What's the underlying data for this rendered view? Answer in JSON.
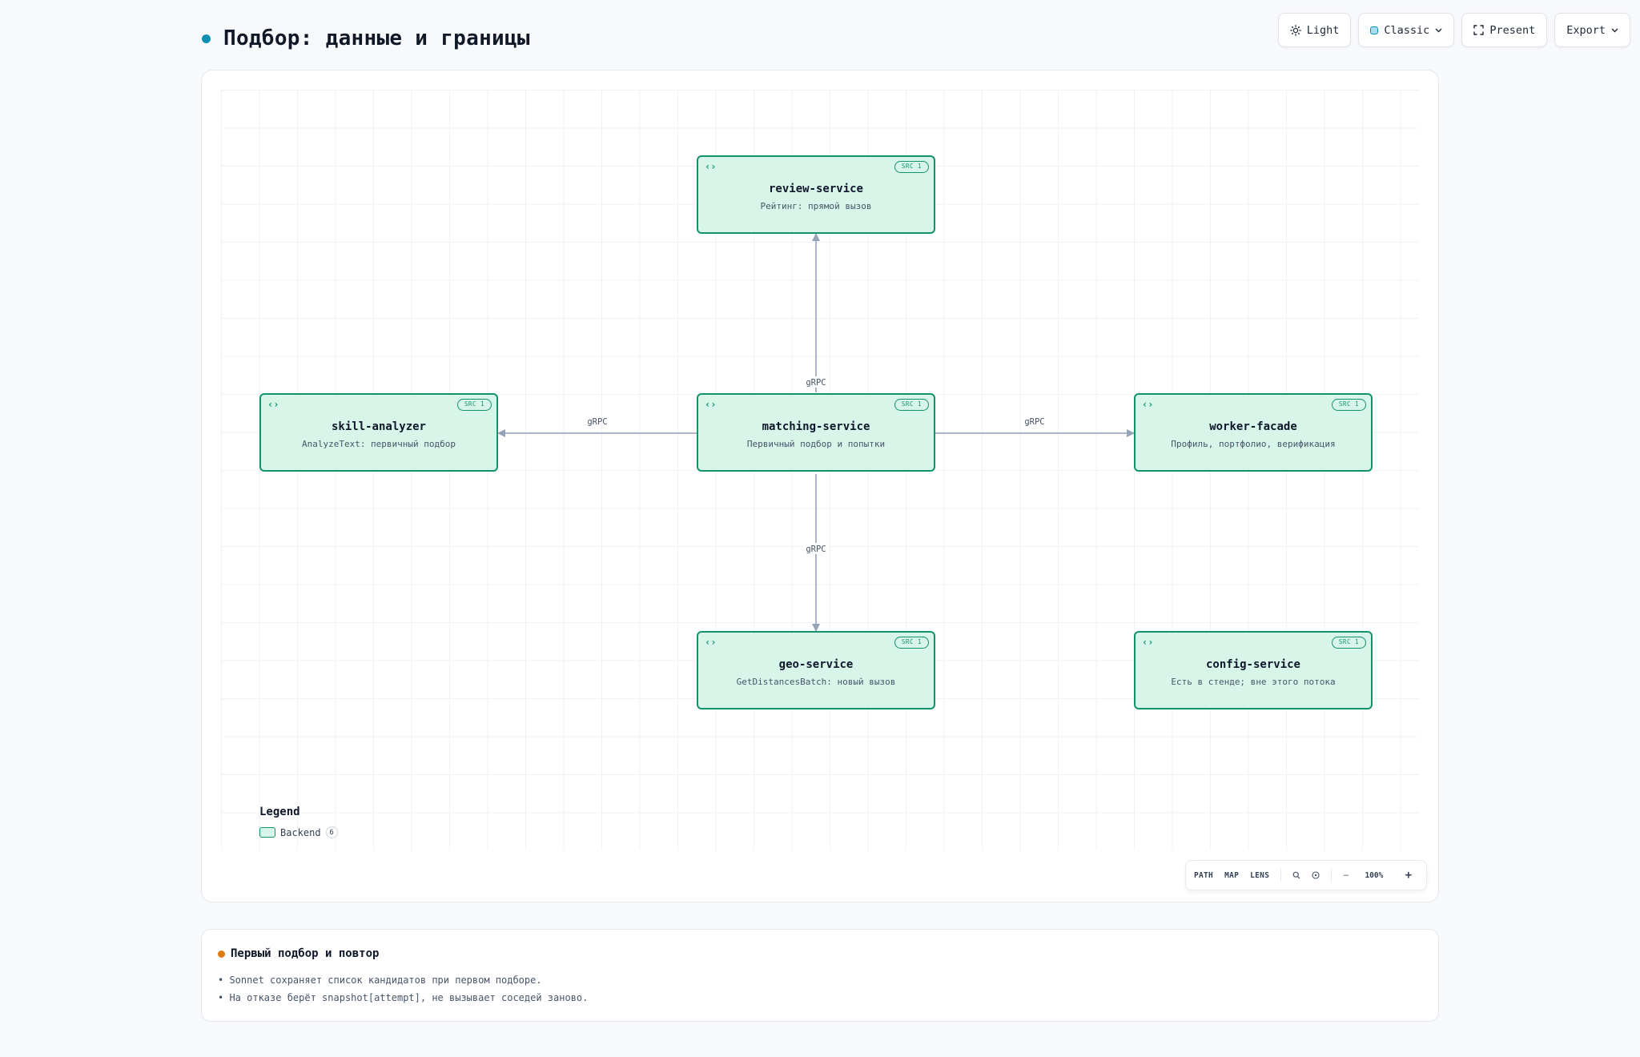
{
  "header": {
    "title": "Подбор: данные и границы",
    "accent_color": "#0e8fb4"
  },
  "toolbar": {
    "theme_label": "Light",
    "style_label": "Classic",
    "present_label": "Present",
    "export_label": "Export"
  },
  "diagram": {
    "nodes": [
      {
        "id": "review",
        "title": "review-service",
        "subtitle": "Рейтинг: прямой вызов",
        "badge": "SRC 1"
      },
      {
        "id": "skill",
        "title": "skill-analyzer",
        "subtitle": "AnalyzeText: первичный подбор",
        "badge": "SRC 1"
      },
      {
        "id": "matching",
        "title": "matching-service",
        "subtitle": "Первичный подбор и попытки",
        "badge": "SRC 1"
      },
      {
        "id": "worker",
        "title": "worker-facade",
        "subtitle": "Профиль, портфолио, верификация",
        "badge": "SRC 1"
      },
      {
        "id": "geo",
        "title": "geo-service",
        "subtitle": "GetDistancesBatch: новый вызов",
        "badge": "SRC 1"
      },
      {
        "id": "config",
        "title": "config-service",
        "subtitle": "Есть в стенде; вне этого потока",
        "badge": "SRC 1"
      }
    ],
    "edges": [
      {
        "from": "matching",
        "to": "review",
        "label": "gRPC"
      },
      {
        "from": "matching",
        "to": "skill",
        "label": "gRPC"
      },
      {
        "from": "matching",
        "to": "worker",
        "label": "gRPC"
      },
      {
        "from": "matching",
        "to": "geo",
        "label": "gRPC"
      }
    ],
    "node_fill": "#d8f5ea",
    "node_stroke": "#129468",
    "edge_color": "#94a3b8"
  },
  "legend": {
    "title": "Legend",
    "items": [
      {
        "label": "Backend",
        "count": "6"
      }
    ]
  },
  "map_controls": {
    "path": "PATH",
    "map": "MAP",
    "lens": "LENS",
    "zoom": "100%",
    "minus": "−",
    "plus": "+"
  },
  "notes": {
    "title": "Первый подбор и повтор",
    "accent_color": "#e07b14",
    "items": [
      "Sonnet сохраняет список кандидатов при первом подборе.",
      "На отказе берёт snapshot[attempt], не вызывает соседей заново."
    ]
  }
}
